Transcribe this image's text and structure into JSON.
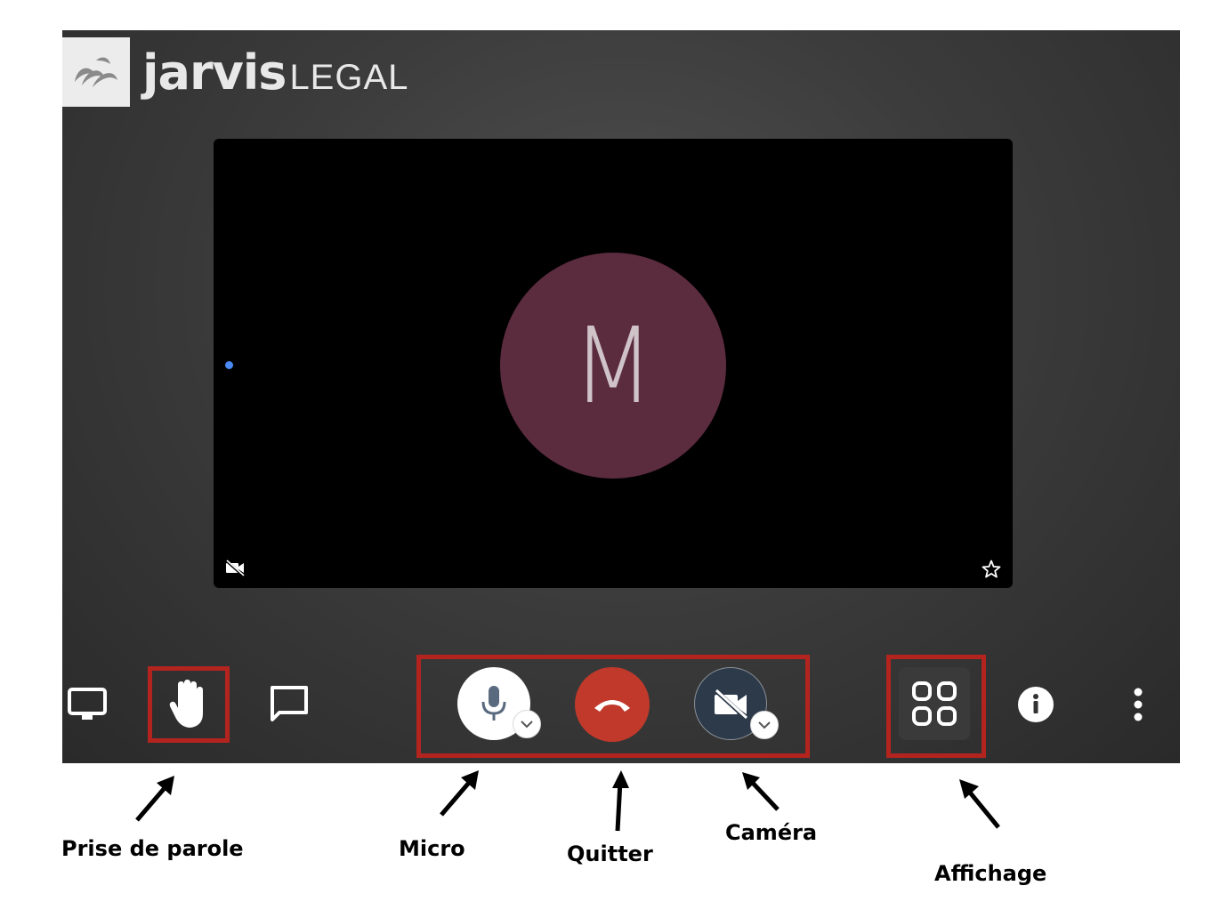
{
  "brand": {
    "name_bold": "jarvis",
    "name_light": "LEGAL"
  },
  "participant": {
    "initial": "M",
    "avatar_color": "#5b2b3e"
  },
  "toolbar": {
    "left": [
      "screen-share-icon",
      "raise-hand-icon",
      "chat-icon"
    ],
    "center": [
      "microphone-icon",
      "hang-up-icon",
      "camera-off-icon"
    ],
    "right": [
      "tile-view-icon",
      "info-icon",
      "more-options-icon"
    ],
    "hangup_color": "#c0392b",
    "camera_button_color": "#2d3a4a"
  },
  "highlight_color": "#b3241f",
  "annotations": {
    "raise_hand": "Prise de parole",
    "micro": "Micro",
    "quit": "Quitter",
    "camera": "Caméra",
    "display": "Affichage"
  }
}
